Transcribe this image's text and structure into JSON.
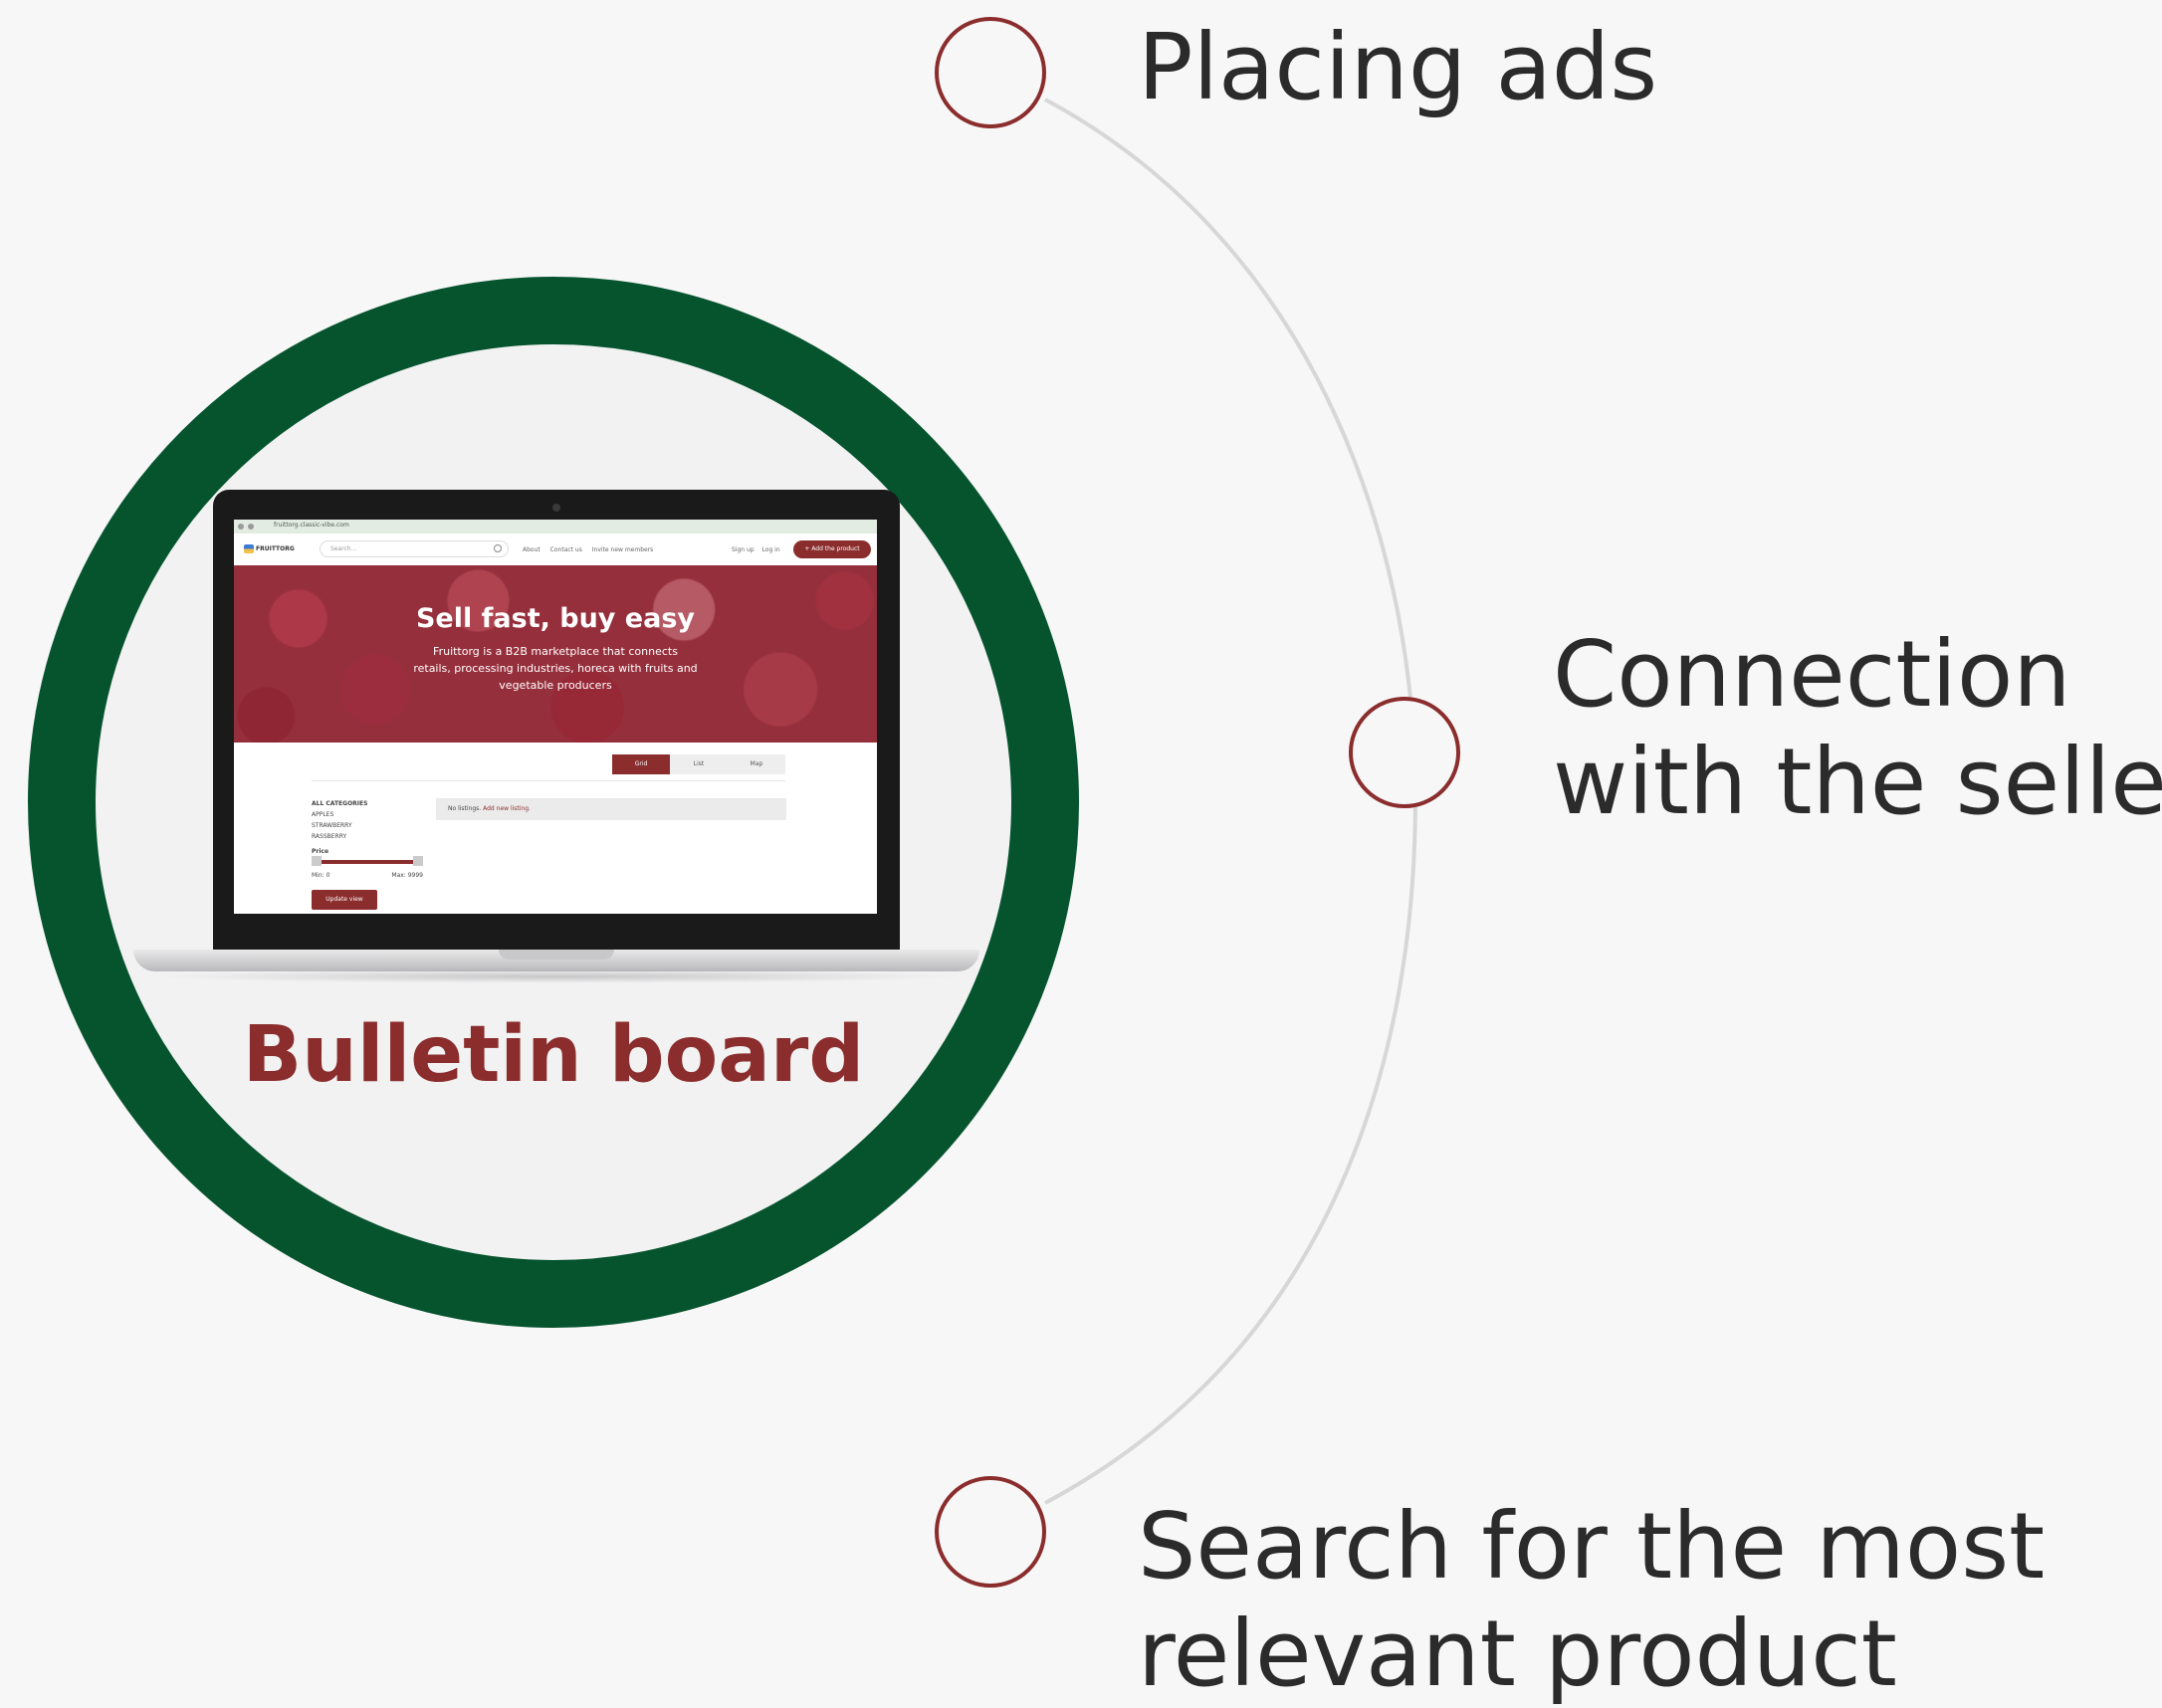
{
  "steps": [
    {
      "label": "Placing ads"
    },
    {
      "label": "Connection\nwith the seller"
    },
    {
      "label": "Search for the most\nrelevant product"
    }
  ],
  "hub": {
    "title": "Bulletin board"
  },
  "screen": {
    "url": "fruittorg.classic-vibe.com",
    "logo": "FRUITTORG",
    "search_placeholder": "Search...",
    "nav_links": [
      "About",
      "Contact us",
      "Invite new members"
    ],
    "sign_links": [
      "Sign up",
      "Log in"
    ],
    "add_button": "+ Add the product",
    "hero_title": "Sell fast, buy easy",
    "hero_subtitle": "Fruittorg is a B2B marketplace that connects retails, processing industries, horeca with fruits and vegetable producers",
    "views": [
      "Grid",
      "List",
      "Map"
    ],
    "categories": {
      "heading": "ALL CATEGORIES",
      "items": [
        "APPLES",
        "STRAWBERRY",
        "RASSBERRY"
      ]
    },
    "price_label": "Price",
    "price_min": "Min: 0",
    "price_max": "Max: 9999",
    "update_button": "Update view",
    "no_listings": "No listings.",
    "add_listing_link": "Add new listing."
  },
  "colors": {
    "accent": "#8b2d2d",
    "ring": "#06542e",
    "connector": "#d7d7d7",
    "text": "#2b2b2b"
  }
}
